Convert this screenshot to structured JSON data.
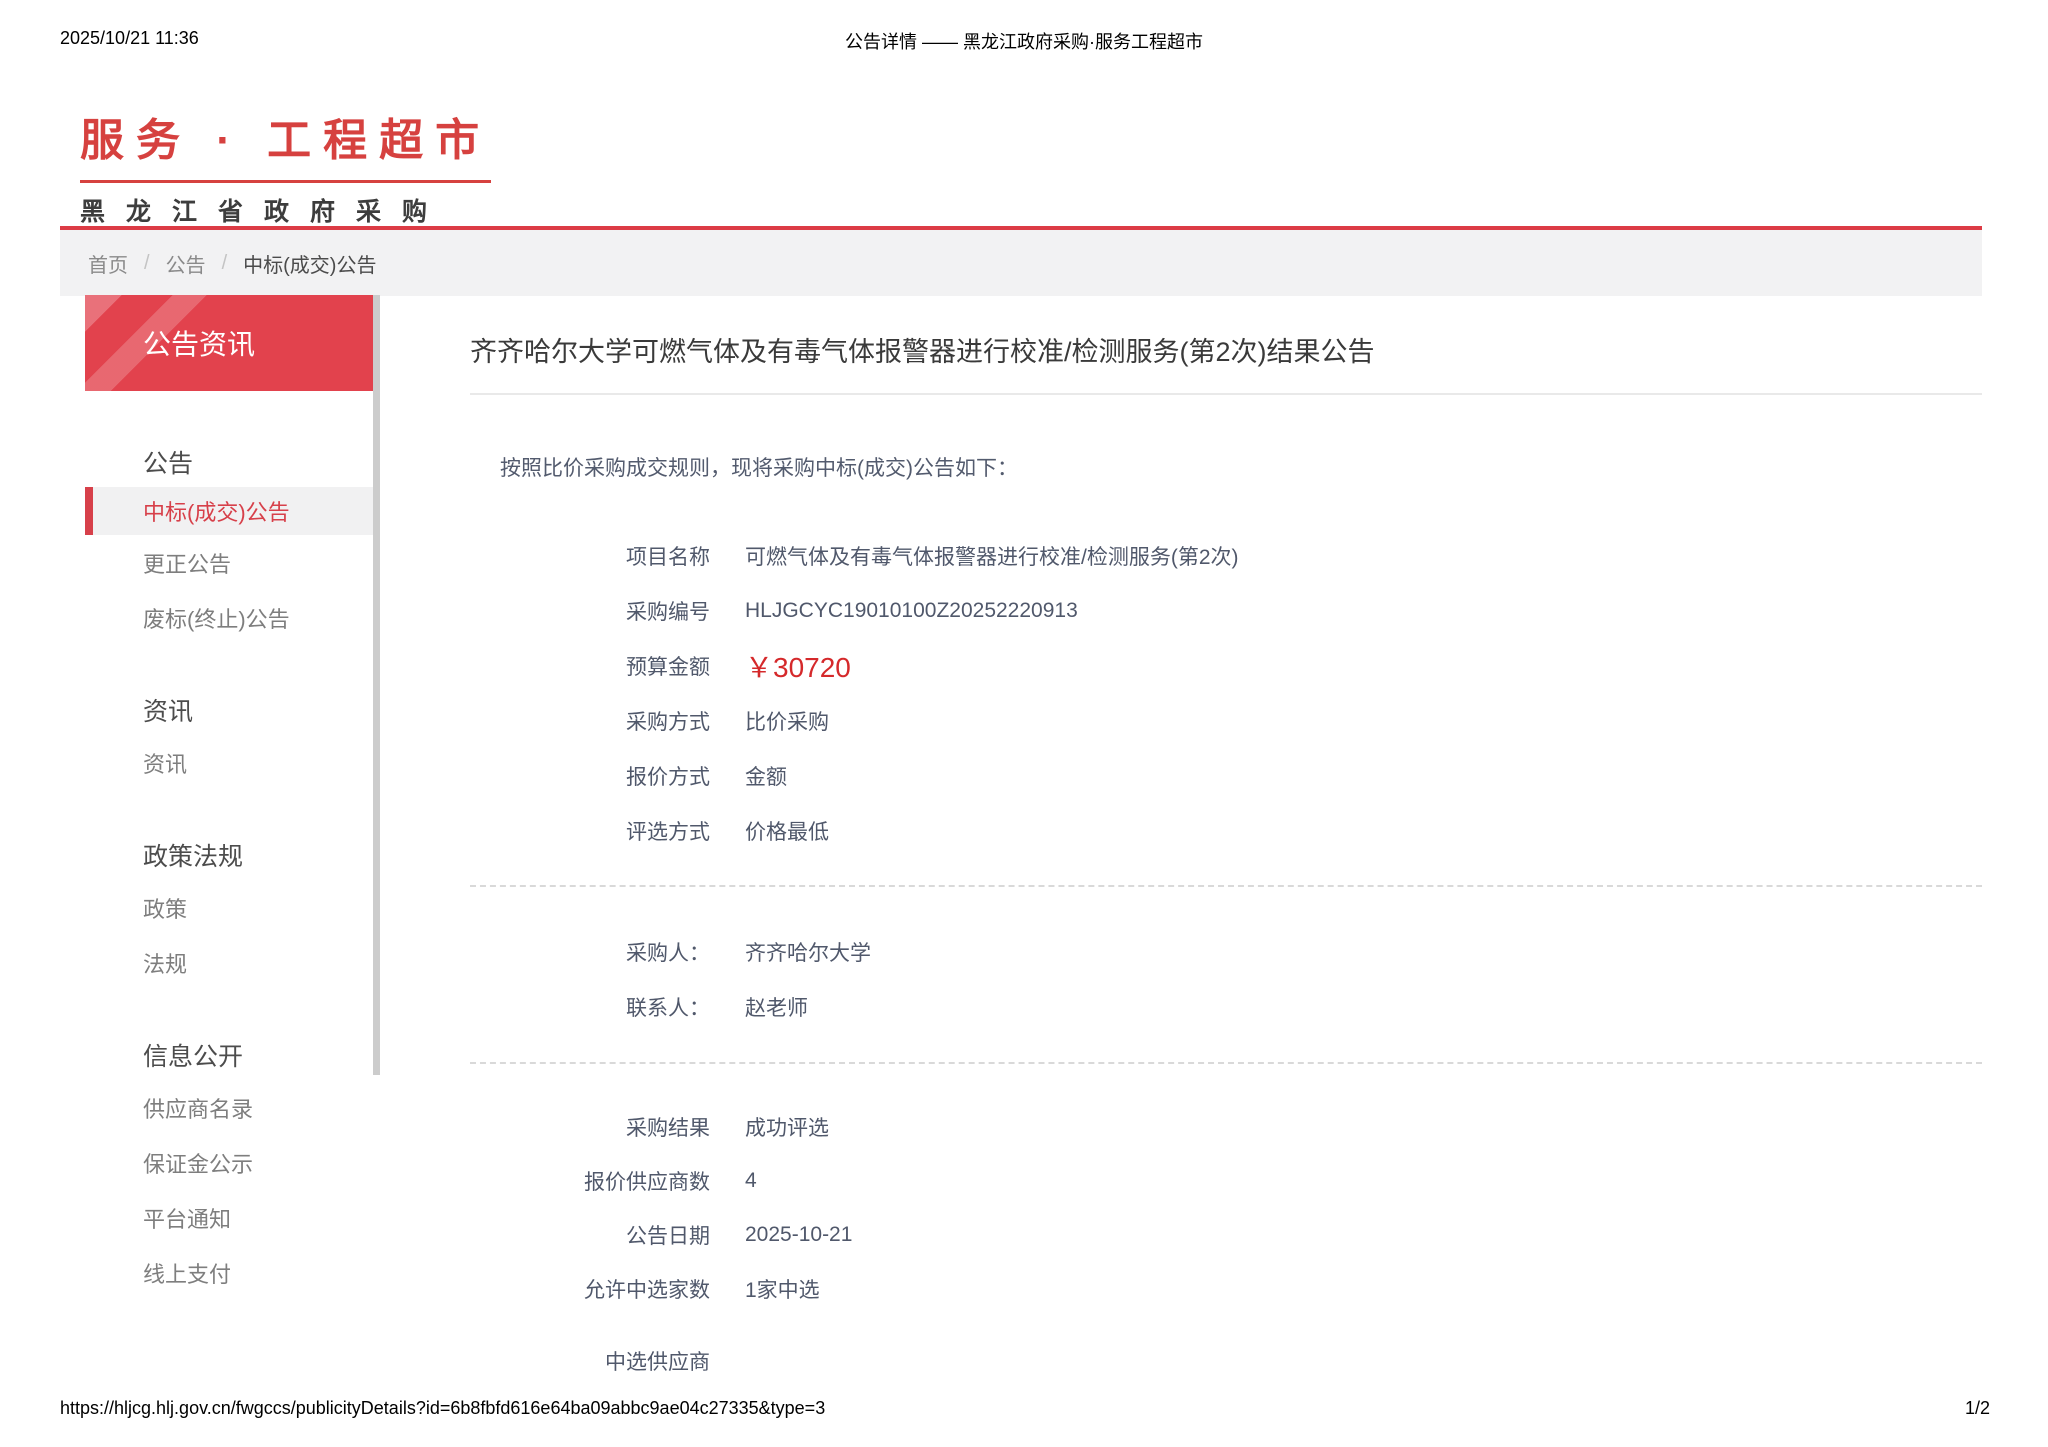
{
  "print_header": {
    "datetime": "2025/10/21 11:36",
    "title": "公告详情 —— 黑龙江政府采购·服务工程超市"
  },
  "brand": {
    "logo_line1": "服务 · 工程超市",
    "logo_line2": "黑龙江省政府采购",
    "colors": {
      "brand_red": "#d6413f",
      "panel_red": "#e2424d",
      "price_red": "#d5292b"
    }
  },
  "breadcrumb": {
    "separator": "/",
    "items": [
      "首页",
      "公告",
      "中标(成交)公告"
    ]
  },
  "sidebar": {
    "header": "公告资讯",
    "sections": [
      {
        "heading": "公告",
        "items": [
          {
            "label": "中标(成交)公告",
            "active": true
          },
          {
            "label": "更正公告"
          },
          {
            "label": "废标(终止)公告"
          }
        ]
      },
      {
        "heading": "资讯",
        "items": [
          {
            "label": "资讯"
          }
        ]
      },
      {
        "heading": "政策法规",
        "items": [
          {
            "label": "政策"
          },
          {
            "label": "法规"
          }
        ]
      },
      {
        "heading": "信息公开",
        "items": [
          {
            "label": "供应商名录"
          },
          {
            "label": "保证金公示"
          },
          {
            "label": "平台通知"
          },
          {
            "label": "线上支付"
          }
        ]
      }
    ]
  },
  "main": {
    "title": "齐齐哈尔大学可燃气体及有毒气体报警器进行校准/检测服务(第2次)结果公告",
    "intro": "按照比价采购成交规则，现将采购中标(成交)公告如下：",
    "groups": [
      {
        "rows": [
          {
            "label": "项目名称",
            "value": "可燃气体及有毒气体报警器进行校准/检测服务(第2次)"
          },
          {
            "label": "采购编号",
            "value": "HLJGCYC19010100Z20252220913"
          },
          {
            "label": "预算金额",
            "value": "￥30720"
          },
          {
            "label": "采购方式",
            "value": "比价采购"
          },
          {
            "label": "报价方式",
            "value": "金额"
          },
          {
            "label": "评选方式",
            "value": "价格最低"
          }
        ]
      },
      {
        "rows": [
          {
            "label": "采购人：",
            "value": "齐齐哈尔大学"
          },
          {
            "label": "联系人：",
            "value": "赵老师"
          }
        ]
      },
      {
        "rows": [
          {
            "label": "采购结果",
            "value": "成功评选"
          },
          {
            "label": "报价供应商数",
            "value": "4"
          },
          {
            "label": "公告日期",
            "value": "2025-10-21"
          },
          {
            "label": "允许中选家数",
            "value": "1家中选"
          }
        ]
      },
      {
        "rows": [
          {
            "label": "中选供应商",
            "value": ""
          }
        ]
      }
    ]
  },
  "print_footer": {
    "url": "https://hljcg.hlj.gov.cn/fwgccs/publicityDetails?id=6b8fbfd616e64ba09abbc9ae04c27335&type=3",
    "page": "1/2"
  }
}
